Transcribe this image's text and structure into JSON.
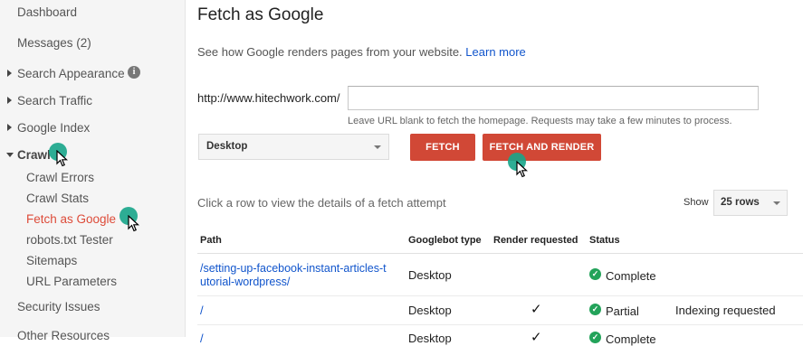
{
  "sidebar": {
    "items": [
      {
        "label": "Dashboard"
      },
      {
        "label": "Messages (2)"
      },
      {
        "label": "Search Appearance"
      },
      {
        "label": "Search Traffic"
      },
      {
        "label": "Google Index"
      },
      {
        "label": "Crawl"
      },
      {
        "label": "Security Issues"
      },
      {
        "label": "Other Resources"
      }
    ],
    "crawl_sub": [
      {
        "label": "Crawl Errors"
      },
      {
        "label": "Crawl Stats"
      },
      {
        "label": "Fetch as Google"
      },
      {
        "label": "robots.txt Tester"
      },
      {
        "label": "Sitemaps"
      },
      {
        "label": "URL Parameters"
      }
    ],
    "info_icon": "i"
  },
  "main": {
    "title": "Fetch as Google",
    "subtitle": "See how Google renders pages from your website.",
    "learn_more": "Learn more",
    "url_prefix": "http://www.hitechwork.com/",
    "url_value": "",
    "hint": "Leave URL blank to fetch the homepage. Requests may take a few minutes to process.",
    "device_select": "Desktop",
    "fetch_button": "FETCH",
    "fetch_render_button": "FETCH AND RENDER",
    "click_text": "Click a row to view the details of a fetch attempt",
    "show_label": "Show",
    "rows_select": "25 rows"
  },
  "table": {
    "headers": [
      "Path",
      "Googlebot type",
      "Render requested",
      "Status"
    ],
    "rows": [
      {
        "path_line1": "/setting-up-facebook-instant-articles-t",
        "path_line2": "utorial-wordpress/",
        "type": "Desktop",
        "render": "",
        "status": "Complete",
        "extra": ""
      },
      {
        "path_line1": "/",
        "path_line2": "",
        "type": "Desktop",
        "render": "✓",
        "status": "Partial",
        "extra": "Indexing requested"
      },
      {
        "path_line1": "/",
        "path_line2": "",
        "type": "Desktop",
        "render": "✓",
        "status": "Complete",
        "extra": ""
      }
    ]
  },
  "colors": {
    "accent_red": "#d14836",
    "active_nav": "#dd4b39",
    "link": "#1155cc",
    "status_green": "#23a35a"
  }
}
